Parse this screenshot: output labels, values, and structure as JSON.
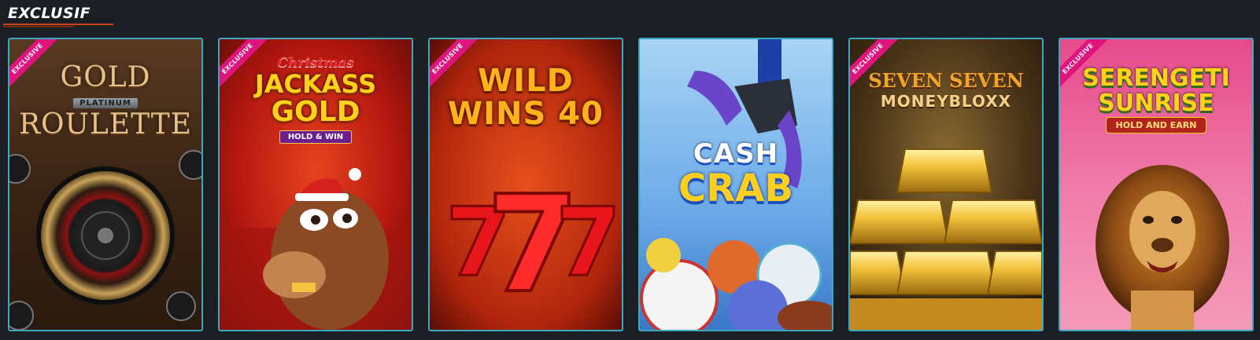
{
  "section": {
    "title": "EXCLUSIF",
    "accent_color": "#3aa9bf",
    "ribbon_color": "#e0147d"
  },
  "games": [
    {
      "ribbon": "EXCLUSIVE",
      "title_line1": "GOLD",
      "title_badge": "PLATINUM",
      "title_line2": "ROULETTE"
    },
    {
      "ribbon": "EXCLUSIVE",
      "title_top": "Christmas",
      "title_line1": "JACKASS",
      "title_line2": "GOLD",
      "title_badge": "HOLD & WIN"
    },
    {
      "ribbon": "EXCLUSIVE",
      "title_line1": "WILD",
      "title_line2": "WINS 40"
    },
    {
      "ribbon": "",
      "title_line1": "CASH",
      "title_line2": "CRAB"
    },
    {
      "ribbon": "EXCLUSIVE",
      "title_line1": "SEVEN SEVEN",
      "title_line2": "MONEYBLOXX"
    },
    {
      "ribbon": "EXCLUSIVE",
      "title_line1": "SERENGETI",
      "title_line2": "SUNRISE",
      "title_badge": "HOLD AND EARN"
    }
  ]
}
